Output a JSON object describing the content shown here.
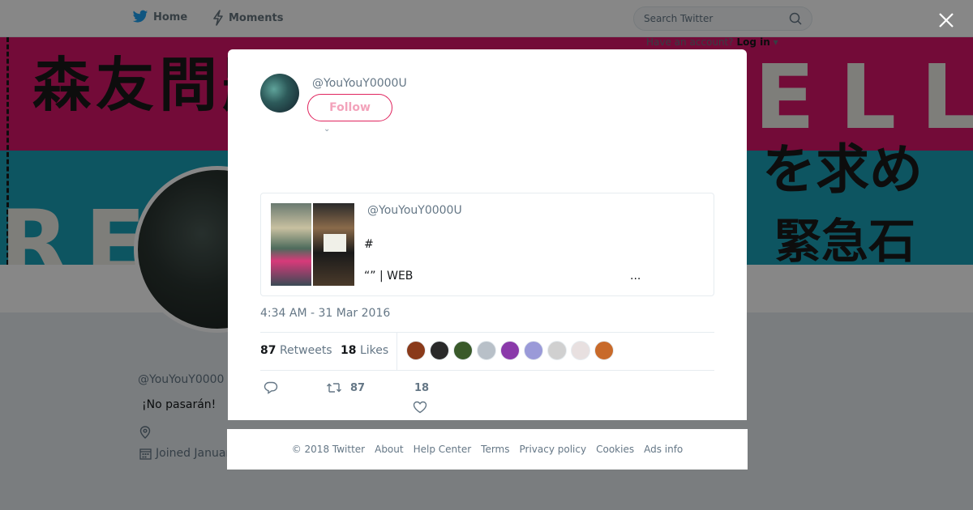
{
  "nav": {
    "home_label": "Home",
    "moments_label": "Moments",
    "search_placeholder": "Search Twitter",
    "have_account": "Have an account?",
    "login_label": "Log in"
  },
  "banner": {
    "top_left_text": "森友問題責任徹明",
    "top_right_text": "ELL",
    "bottom_left_text": "RE",
    "right_text": "を求め",
    "bottom_right_text": "緊急石"
  },
  "profile": {
    "name": "",
    "handle": "@YouYouY0000",
    "bio": "¡No pasarán!",
    "joined": "Joined Januar"
  },
  "tweet": {
    "handle": "@YouYouY0000U",
    "follow_label": "Follow",
    "text_line1": "",
    "text_line2": "",
    "quote": {
      "handle": "@YouYouY0000U",
      "hashtag": "#",
      "line": "“” |  WEB",
      "more": "..."
    },
    "timestamp": "4:34 AM - 31 Mar 2016",
    "retweets_count": "87",
    "retweets_label": "Retweets",
    "likes_count": "18",
    "likes_label": "Likes",
    "reply_count": "",
    "retweet_action_count": "87",
    "like_action_count": "18",
    "liker_avatars": [
      "#8a3a1a",
      "#2a2a2a",
      "#3a5a2a",
      "#b8c0c8",
      "#8a3aaa",
      "#9a9ad8",
      "#d0d0d0",
      "#e8e0e0",
      "#c86a2a"
    ]
  },
  "footer": {
    "links": [
      "© 2018 Twitter",
      "About",
      "Help Center",
      "Terms",
      "Privacy policy",
      "Cookies",
      "Ads info"
    ]
  }
}
